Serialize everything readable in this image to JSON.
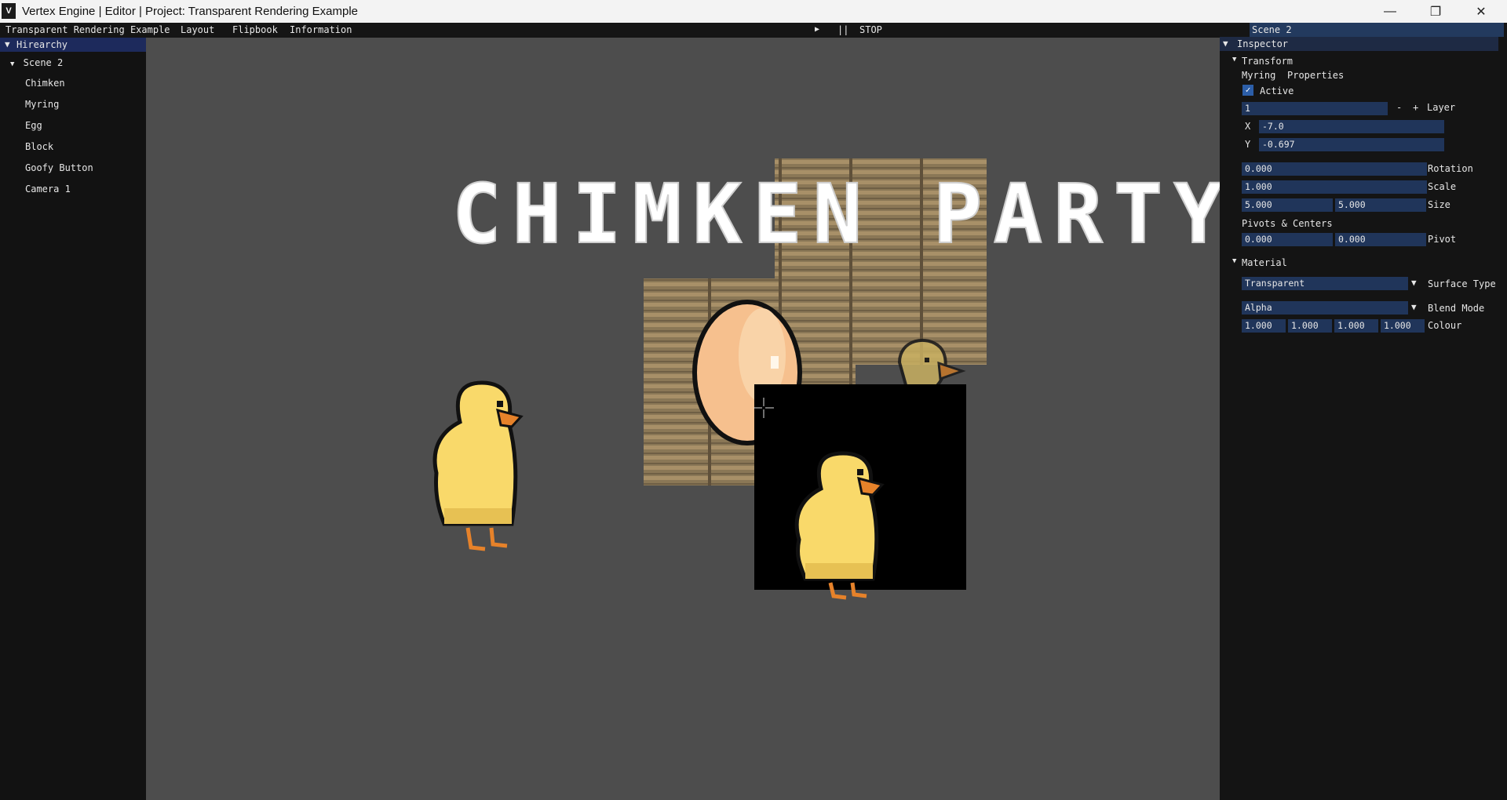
{
  "window": {
    "title": "Vertex Engine | Editor | Project: Transparent Rendering Example",
    "app_icon_glyph": "V",
    "minimize_glyph": "—",
    "restore_glyph": "❐",
    "close_glyph": "✕"
  },
  "menubar": {
    "items": [
      "Transparent Rendering Example",
      "Layout",
      "Flipbook",
      "Information"
    ],
    "play_glyph": "▶",
    "pause_label": "||",
    "stop_label": "STOP",
    "scene_tab": "Scene 2"
  },
  "hierarchy": {
    "title": "Hirearchy",
    "scene": "Scene 2",
    "items": [
      "Chimken",
      "Myring",
      "Egg",
      "Block",
      "Goofy Button",
      "Camera 1"
    ]
  },
  "viewport": {
    "title_text": "CHIMKEN PARTY"
  },
  "inspector": {
    "title": "Inspector",
    "transform": {
      "label": "Transform",
      "object_name": "Myring",
      "properties_label": "Properties",
      "active_label": "Active",
      "active": true,
      "layer_value": "1",
      "minus": "-",
      "plus": "+",
      "layer_label": "Layer",
      "x_label": "X",
      "x_value": "-7.0",
      "y_label": "Y",
      "y_value": "-0.697",
      "rotation_value": "0.000",
      "rotation_label": "Rotation",
      "scale_value": "1.000",
      "scale_label": "Scale",
      "size_x": "5.000",
      "size_y": "5.000",
      "size_label": "Size",
      "pivots_label": "Pivots & Centers",
      "pivot_x": "0.000",
      "pivot_y": "0.000",
      "pivot_label": "Pivot"
    },
    "material": {
      "label": "Material",
      "surface_value": "Transparent",
      "surface_label": "Surface Type",
      "blend_value": "Alpha",
      "blend_label": "Blend Mode",
      "colour": [
        "1.000",
        "1.000",
        "1.000",
        "1.000"
      ],
      "colour_label": "Colour"
    }
  },
  "colors": {
    "accent": "#2c5ea8",
    "field_bg": "#20355a",
    "duck_body": "#f9d96a",
    "duck_beak": "#e6822a",
    "egg": "#f6c08e"
  }
}
